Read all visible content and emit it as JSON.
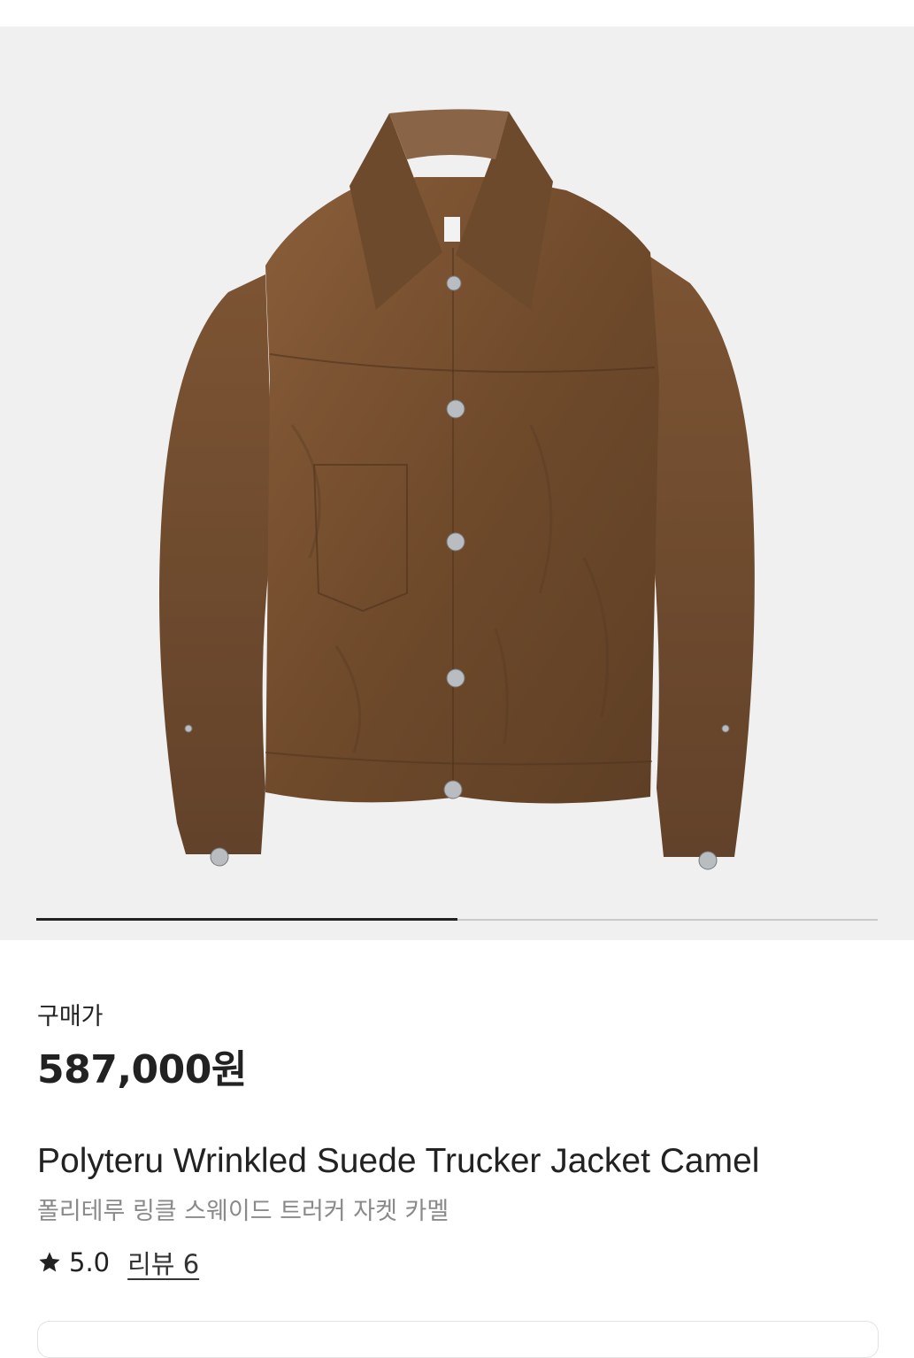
{
  "product": {
    "image_alt": "Polyteru Wrinkled Suede Trucker Jacket Camel",
    "image_color": "#7a5332",
    "gallery_progress": 0.5,
    "price_label": "구매가",
    "price": "587,000원",
    "title_en": "Polyteru Wrinkled Suede Trucker Jacket Camel",
    "title_ko": "폴리테루 링클 스웨이드 트러커 자켓 카멜",
    "rating": "5.0",
    "review_link": "리뷰 6"
  }
}
